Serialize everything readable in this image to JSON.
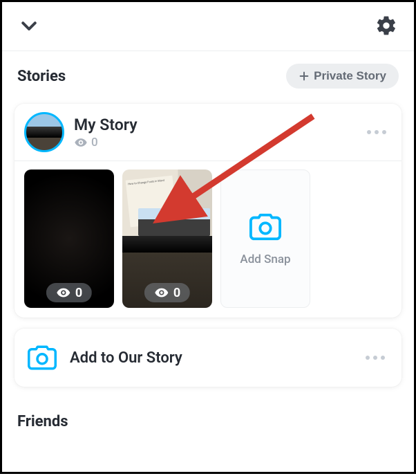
{
  "header": {
    "stories_title": "Stories",
    "private_story_label": "Private Story"
  },
  "my_story": {
    "title": "My Story",
    "view_count": "0",
    "snaps": [
      {
        "views": "0"
      },
      {
        "views": "0"
      }
    ],
    "add_snap_label": "Add Snap"
  },
  "our_story": {
    "label": "Add to Our Story"
  },
  "friends": {
    "title": "Friends"
  }
}
